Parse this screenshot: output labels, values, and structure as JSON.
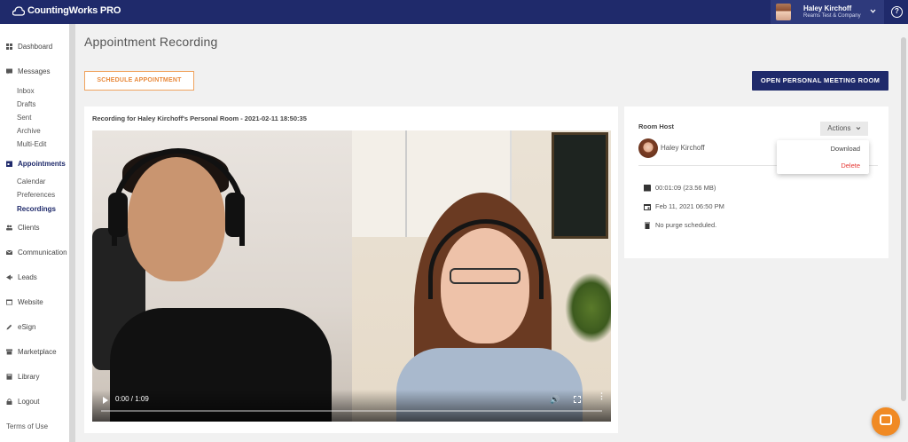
{
  "topbar": {
    "brand": "CountingWorks PRO",
    "user_name": "Haley Kirchoff",
    "user_company": "Reams Test & Company"
  },
  "sidebar": {
    "items": [
      {
        "label": "Dashboard",
        "icon": "dashboard-icon"
      },
      {
        "label": "Messages",
        "icon": "messages-icon"
      },
      {
        "label": "Appointments",
        "icon": "calendar-icon",
        "active": true
      },
      {
        "label": "Clients",
        "icon": "clients-icon"
      },
      {
        "label": "Communication",
        "icon": "mail-icon"
      },
      {
        "label": "Leads",
        "icon": "leads-icon"
      },
      {
        "label": "Website",
        "icon": "website-icon"
      },
      {
        "label": "eSign",
        "icon": "pen-icon"
      },
      {
        "label": "Marketplace",
        "icon": "store-icon"
      },
      {
        "label": "Library",
        "icon": "book-icon"
      },
      {
        "label": "Logout",
        "icon": "lock-icon"
      }
    ],
    "messages_sub": [
      "Inbox",
      "Drafts",
      "Sent",
      "Archive",
      "Multi-Edit"
    ],
    "appointments_sub": [
      "Calendar",
      "Preferences",
      "Recordings"
    ],
    "terms": "Terms of Use"
  },
  "main": {
    "title": "Appointment Recording",
    "schedule_button": "SCHEDULE APPOINTMENT",
    "open_room_button": "OPEN PERSONAL MEETING ROOM",
    "recording_title": "Recording for Haley Kirchoff's Personal Room - 2021-02-11 18:50:35",
    "video_time": "0:00 / 1:09",
    "video_progress": 0
  },
  "info": {
    "room_host_label": "Room Host",
    "actions_label": "Actions",
    "host_name": "Haley Kirchoff",
    "duration": "00:01:09 (23.56 MB)",
    "date": "Feb 11, 2021 06:50 PM",
    "purge": "No purge scheduled."
  },
  "dropdown": {
    "download": "Download",
    "delete": "Delete"
  },
  "colors": {
    "brand_navy": "#1f2a6b",
    "accent_orange": "#f08a24",
    "delete_red": "#e53935"
  }
}
